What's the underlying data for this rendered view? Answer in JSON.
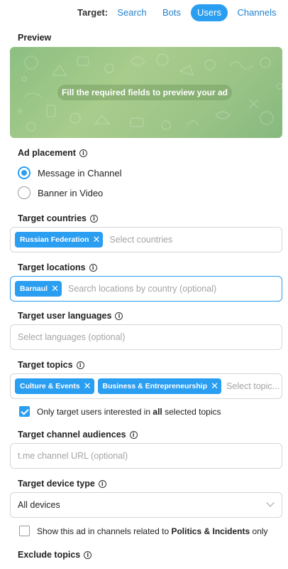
{
  "target": {
    "label": "Target:",
    "tabs": [
      {
        "label": "Search",
        "active": false
      },
      {
        "label": "Bots",
        "active": false
      },
      {
        "label": "Users",
        "active": true
      },
      {
        "label": "Channels",
        "active": false
      }
    ]
  },
  "preview": {
    "title": "Preview",
    "message": "Fill the required fields to preview your ad"
  },
  "placement": {
    "title": "Ad placement",
    "options": [
      {
        "label": "Message in Channel",
        "selected": true
      },
      {
        "label": "Banner in Video",
        "selected": false
      }
    ]
  },
  "countries": {
    "title": "Target countries",
    "chips": [
      "Russian Federation"
    ],
    "placeholder": "Select countries"
  },
  "locations": {
    "title": "Target locations",
    "chips": [
      "Barnaul"
    ],
    "placeholder": "Search locations by country (optional)"
  },
  "languages": {
    "title": "Target user languages",
    "placeholder": "Select languages (optional)"
  },
  "topics": {
    "title": "Target topics",
    "chips": [
      "Culture & Events",
      "Business & Entrepreneurship"
    ],
    "placeholder": "Select topic...",
    "only_interested_prefix": "Only target users interested in",
    "only_interested_bold": "all",
    "only_interested_suffix": "selected topics",
    "only_interested_checked": true
  },
  "audiences": {
    "title": "Target channel audiences",
    "placeholder": "t.me channel URL (optional)"
  },
  "device": {
    "title": "Target device type",
    "value": "All devices",
    "politics_prefix": "Show this ad in channels related to",
    "politics_bold": "Politics & Incidents",
    "politics_suffix": "only",
    "politics_checked": false
  },
  "exclude": {
    "title": "Exclude topics"
  },
  "colors": {
    "accent": "#2a9ef1",
    "link": "#2481cc",
    "preview_bg": "#9cc488"
  }
}
